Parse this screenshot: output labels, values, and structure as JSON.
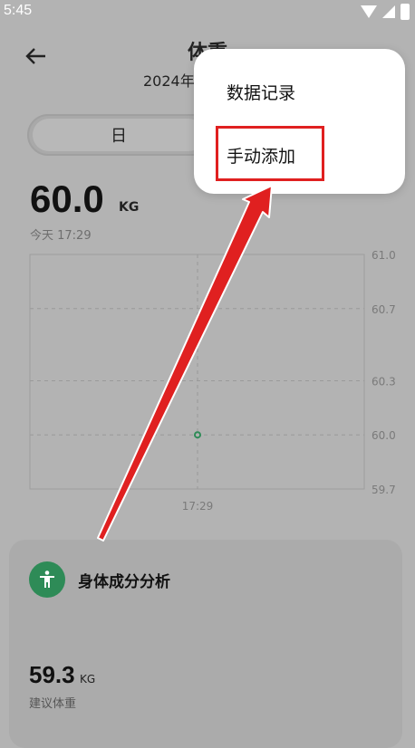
{
  "status_bar": {
    "time": "5:45"
  },
  "header": {
    "title": "体重",
    "subtitle": "2024年"
  },
  "tabs": {
    "day": "日"
  },
  "weight": {
    "value": "60.0",
    "unit": "KG",
    "time": "今天 17:29"
  },
  "chart_data": {
    "type": "scatter",
    "x": [
      "17:29"
    ],
    "y": [
      60.0
    ],
    "y_ticks": [
      "61.0",
      "60.7",
      "60.3",
      "60.0",
      "59.7"
    ],
    "x_tick_labels": [
      "17:29"
    ],
    "ylim": [
      59.7,
      61.0
    ],
    "point_color": "#2e8b57"
  },
  "card": {
    "title": "身体成分分析",
    "ideal_value": "59.3",
    "ideal_unit": "KG",
    "ideal_label": "建议体重"
  },
  "menu": {
    "items": [
      "数据记录",
      "手动添加"
    ]
  },
  "colors": {
    "accent_green": "#2e8b57",
    "annotation_red": "#e02020"
  }
}
